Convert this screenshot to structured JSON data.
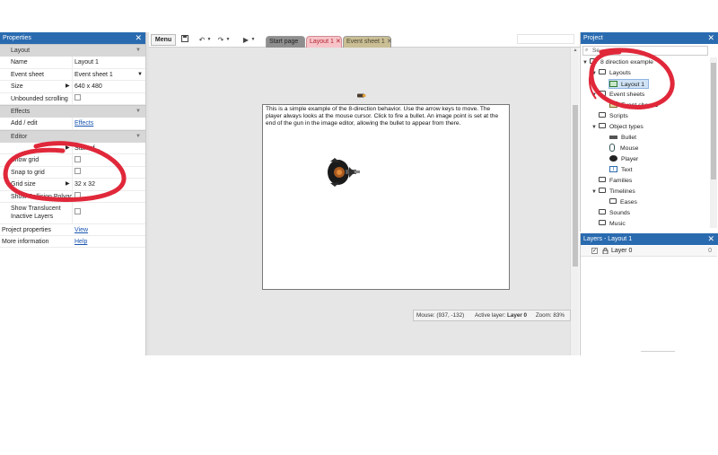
{
  "properties": {
    "title": "Properties",
    "close": "✕",
    "sections": {
      "layout": "Layout",
      "effects": "Effects",
      "editor": "Editor"
    },
    "layout_rows": [
      {
        "key": "Name",
        "value": "Layout 1"
      },
      {
        "key": "Event sheet",
        "value": "Event sheet 1"
      },
      {
        "key": "Size",
        "value": "640 x 480"
      },
      {
        "key": "Unbounded scrolling",
        "value": ""
      }
    ],
    "effects_row": {
      "key": "Add / edit",
      "value": "Effects"
    },
    "editor_rows": [
      {
        "key": "",
        "value": "Start of..."
      },
      {
        "key": "Show grid",
        "value": ""
      },
      {
        "key": "Snap to grid",
        "value": ""
      },
      {
        "key": "Grid size",
        "value": "32 x 32"
      },
      {
        "key": "Show Collision Polygons",
        "value": ""
      },
      {
        "key": "Show Translucent Inactive Layers",
        "value": ""
      }
    ],
    "project_properties": {
      "key": "Project properties",
      "value": "View"
    },
    "more_information": {
      "key": "More information",
      "value": "Help"
    }
  },
  "toolbar": {
    "menu_label": "Menu",
    "tabs": [
      {
        "label": "Start page"
      },
      {
        "label": "Layout 1",
        "close": "✕"
      },
      {
        "label": "Event sheet 1",
        "close": "✕"
      }
    ]
  },
  "canvas": {
    "description_text": "This is a simple example of the 8-direction behavior. Use the arrow keys to move. The player always looks at the mouse cursor. Click to fire a bullet. An image point is set at the end of the gun in the image editor, allowing the bullet to appear from there."
  },
  "statusbar": {
    "mouse": "Mouse: (937, -132)",
    "active_layer_label": "Active layer:",
    "active_layer_value": "Layer 0",
    "zoom": "Zoom: 83%"
  },
  "project": {
    "title": "Project",
    "close": "✕",
    "search_placeholder": "Se...",
    "tree": {
      "root": "8 direction example",
      "layouts": "Layouts",
      "layout_1": "Layout 1",
      "event_sheets": "Event sheets",
      "event_sheet_1": "Event sheet 1",
      "scripts": "Scripts",
      "object_types": "Object types",
      "bullet": "Bullet",
      "mouse": "Mouse",
      "player": "Player",
      "text": "Text",
      "families": "Families",
      "timelines": "Timelines",
      "eases": "Eases",
      "sounds": "Sounds",
      "music": "Music"
    }
  },
  "layers": {
    "title": "Layers - Layout 1",
    "close": "✕",
    "rows": [
      {
        "name": "Layer 0",
        "index": "0",
        "check": "✓"
      }
    ]
  },
  "colors": {
    "panel_header": "#2a6bb0",
    "annotation_red": "#e0283a",
    "tab_active_bg": "#f6c4c9",
    "tab_events_bg": "#c9be94"
  }
}
